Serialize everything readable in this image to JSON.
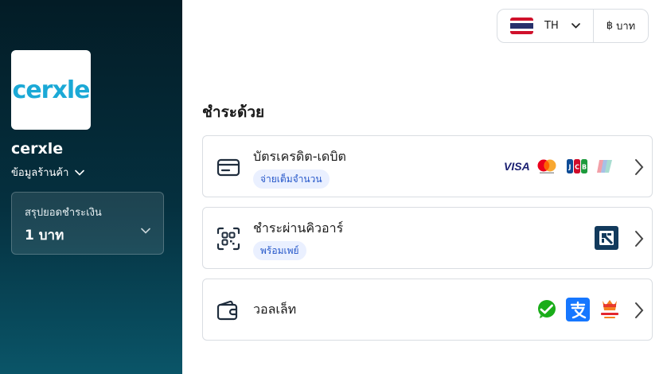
{
  "sidebar": {
    "logo_text": "cerxle",
    "merchant_name": "cerxle",
    "store_info_label": "ข้อมูลร้านค้า",
    "summary": {
      "label": "สรุปยอดชำระเงิน",
      "amount": "1 บาท"
    }
  },
  "header": {
    "language": {
      "code": "TH",
      "flag": "thailand-flag"
    },
    "currency": {
      "symbol": "฿",
      "label": "บาท"
    }
  },
  "main": {
    "title": "ชำระด้วย",
    "methods": [
      {
        "title": "บัตรเครดิต-เดบิต",
        "badge": "จ่ายเต็มจำนวน",
        "icon": "credit-card-icon",
        "logos": [
          "visa-logo",
          "mastercard-logo",
          "jcb-logo",
          "unionpay-logo"
        ],
        "visa_text": "VISA"
      },
      {
        "title": "ชำระผ่านคิวอาร์",
        "badge": "พร้อมเพย์",
        "icon": "qr-scan-icon",
        "logos": [
          "thai-qr-payment-logo"
        ]
      },
      {
        "title": "วอลเล็ท",
        "badge": "",
        "icon": "wallet-icon",
        "logos": [
          "wechat-pay-logo",
          "alipay-logo",
          "truemoney-wallet-logo"
        ]
      }
    ]
  },
  "colors": {
    "accent": "#1ba9d6",
    "badge_bg": "#eaf0ff",
    "badge_text": "#2456c9",
    "sidebar_top": "#031c26",
    "sidebar_bottom": "#0a5568"
  }
}
